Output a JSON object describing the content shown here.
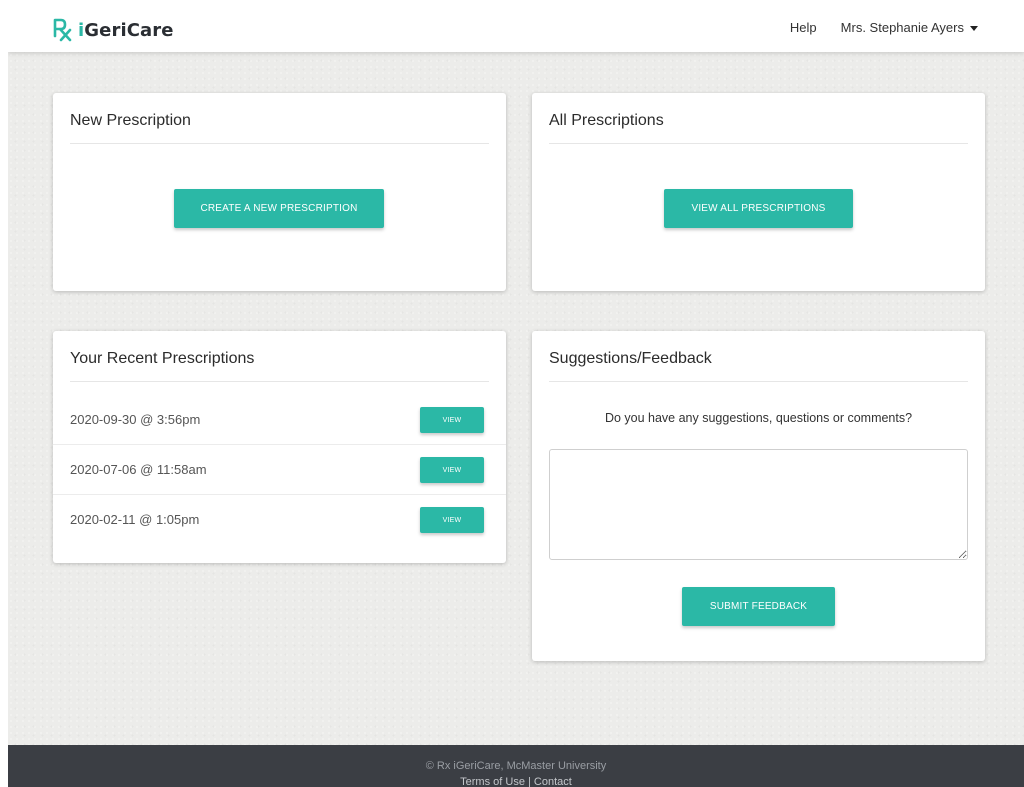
{
  "brand": {
    "name": "iGeriCare",
    "accent_color": "#2bb8a6"
  },
  "nav": {
    "help": "Help",
    "user_name": "Mrs. Stephanie Ayers"
  },
  "new_prescription": {
    "title": "New Prescription",
    "button": "CREATE A NEW PRESCRIPTION"
  },
  "all_prescriptions": {
    "title": "All Prescriptions",
    "button": "VIEW ALL PRESCRIPTIONS"
  },
  "recent_prescriptions": {
    "title": "Your Recent Prescriptions",
    "view_label": "VIEW",
    "items": [
      {
        "date": "2020-09-30 @ 3:56pm"
      },
      {
        "date": "2020-07-06 @ 11:58am"
      },
      {
        "date": "2020-02-11 @ 1:05pm"
      }
    ]
  },
  "feedback": {
    "title": "Suggestions/Feedback",
    "question": "Do you have any suggestions, questions or comments?",
    "textarea_value": "",
    "button": "SUBMIT FEEDBACK"
  },
  "footer": {
    "copyright": "© Rx iGeriCare, McMaster University",
    "terms": "Terms of Use",
    "separator": " | ",
    "contact": "Contact"
  }
}
